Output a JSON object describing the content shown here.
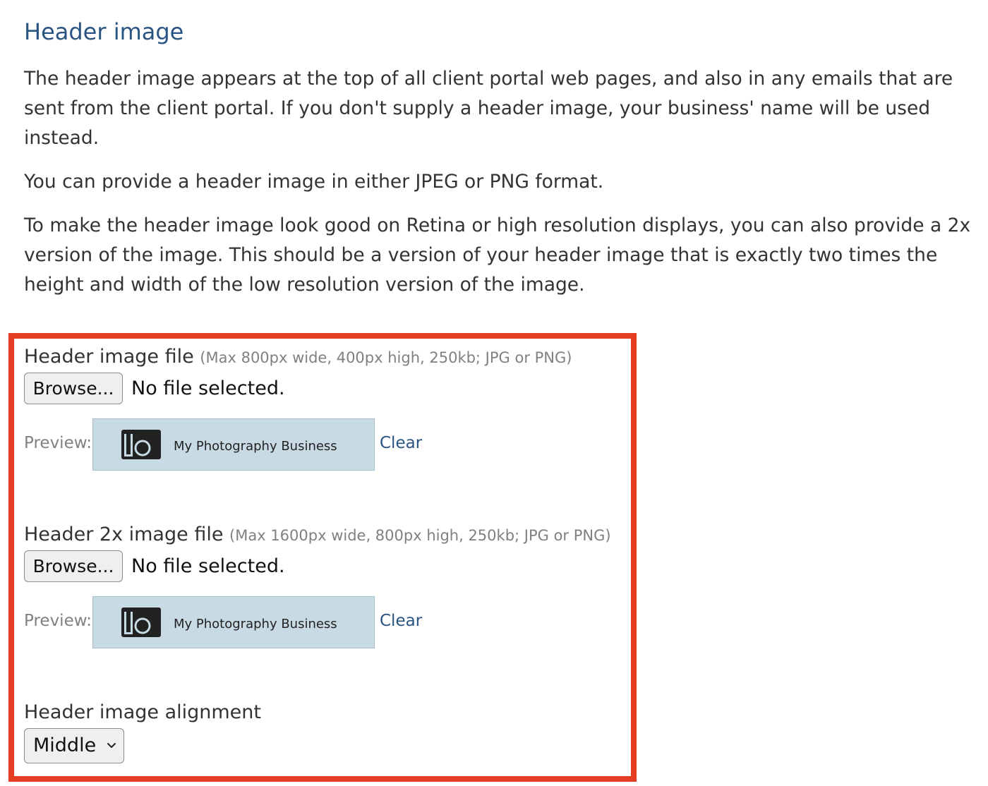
{
  "section": {
    "title": "Header image",
    "paragraphs": [
      "The header image appears at the top of all client portal web pages, and also in any emails that are sent from the client portal. If you don't supply a header image, your business' name will be used instead.",
      "You can provide a header image in either JPEG or PNG format.",
      "To make the header image look good on Retina or high resolution displays, you can also provide a 2x version of the image. This should be a version of your header image that is exactly two times the height and width of the low resolution version of the image."
    ]
  },
  "header_image": {
    "label": "Header image file",
    "hint": "(Max 800px wide, 400px high, 250kb; JPG or PNG)",
    "browse_label": "Browse...",
    "file_status": "No file selected.",
    "preview_label": "Preview:",
    "preview_text": "My Photography Business",
    "clear_label": "Clear"
  },
  "header_2x_image": {
    "label": "Header 2x image file",
    "hint": "(Max 1600px wide, 800px high, 250kb; JPG or PNG)",
    "browse_label": "Browse...",
    "file_status": "No file selected.",
    "preview_label": "Preview:",
    "preview_text": "My Photography Business",
    "clear_label": "Clear"
  },
  "alignment": {
    "label": "Header image alignment",
    "selected": "Middle"
  },
  "icons": {
    "logo": "lb-logo-icon",
    "dropdown": "chevron-down-icon"
  },
  "colors": {
    "title": "#2a5481",
    "link": "#2a5481",
    "highlight_border": "#e43d22",
    "preview_background": "#c8dae4",
    "logo": "#222222"
  }
}
